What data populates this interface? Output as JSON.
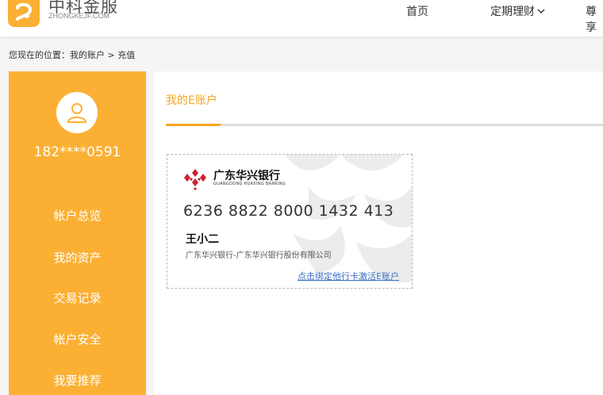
{
  "header": {
    "logo_name": "中科金服",
    "logo_domain": "ZHONGKEJF.COM",
    "nav": {
      "home": "首页",
      "fixed": "定期理财",
      "more": "尊享"
    }
  },
  "breadcrumb": "您现在的位置：我的账户 > 充值",
  "sidebar": {
    "phone": "182****0591",
    "items": [
      {
        "label": "帐户总览"
      },
      {
        "label": "我的资产"
      },
      {
        "label": "交易记录"
      },
      {
        "label": "帐户安全"
      },
      {
        "label": "我要推荐"
      }
    ]
  },
  "main": {
    "tab_title": "我的E账户",
    "card": {
      "bank_name": "广东华兴银行",
      "bank_name_en": "GUANGDONG HUAXING BANKING",
      "card_number": "6236 8822 8000 1432 413",
      "holder_name": "王小二",
      "bank_full": "广东华兴银行-广东华兴银行股份有限公司",
      "activate_link": "点击绑定他行卡激活E账户"
    }
  },
  "colors": {
    "brand": "#fbb034",
    "accent_text": "#f5a623",
    "link": "#3a6fc4",
    "bank_red": "#d0202a"
  }
}
